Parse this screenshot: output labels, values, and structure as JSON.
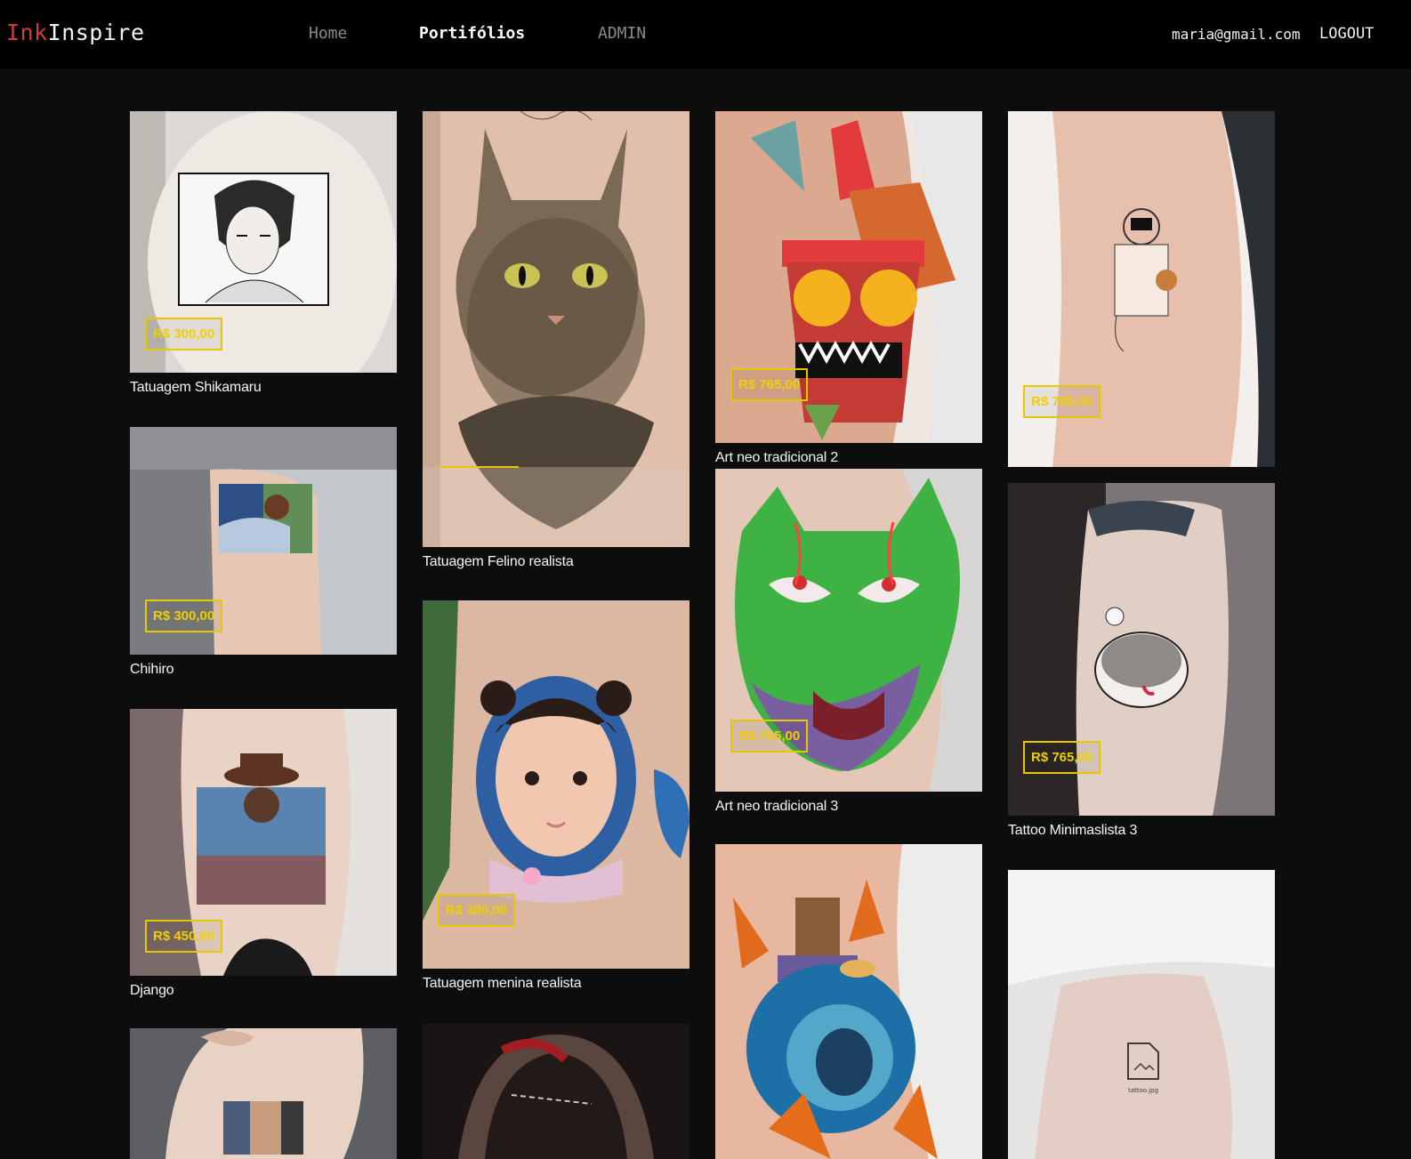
{
  "brand": {
    "part1": "Ink",
    "part2": "Inspire",
    "accent": "#d13b3b"
  },
  "nav": {
    "home": "Home",
    "portfolios": "Portifólios",
    "admin": "ADMIN"
  },
  "user": {
    "email": "maria@gmail.com",
    "logout": "LOGOUT"
  },
  "price_color": "#f0cf00",
  "cards": [
    {
      "title": "Tatuagem Shikamaru",
      "price": "R$ 300,00",
      "icon": "anime-portrait-tattoo"
    },
    {
      "title": "Chihiro",
      "price": "R$ 300,00",
      "icon": "anime-scene-tattoo"
    },
    {
      "title": "Django",
      "price": "R$ 450,00",
      "icon": "cowboy-portrait-tattoo"
    },
    {
      "title": "",
      "price": "",
      "icon": "couple-tattoo"
    },
    {
      "title": "Tatuagem Felino realista",
      "price": "",
      "icon": "cat-tattoo"
    },
    {
      "title": "Tatuagem menina realista",
      "price": "R$ 300,00",
      "icon": "girl-portrait-tattoo"
    },
    {
      "title": "",
      "price": "",
      "icon": "dark-tattoo"
    },
    {
      "title": "Art neo tradicional 2",
      "price": "R$ 765,00",
      "icon": "tiki-mask-tattoo"
    },
    {
      "title": "Art neo tradicional 3",
      "price": "R$ 765,00",
      "icon": "tiger-mask-tattoo"
    },
    {
      "title": "",
      "price": "",
      "icon": "potion-bottle-tattoo"
    },
    {
      "title": "",
      "price": "R$ 765,00",
      "icon": "astronaut-tattoo"
    },
    {
      "title": "Tattoo Minimaslista 3",
      "price": "R$ 765,00",
      "icon": "kitten-tattoo"
    },
    {
      "title": "",
      "price": "",
      "icon": "file-icon-tattoo",
      "label": "tattoo.jpg"
    }
  ]
}
